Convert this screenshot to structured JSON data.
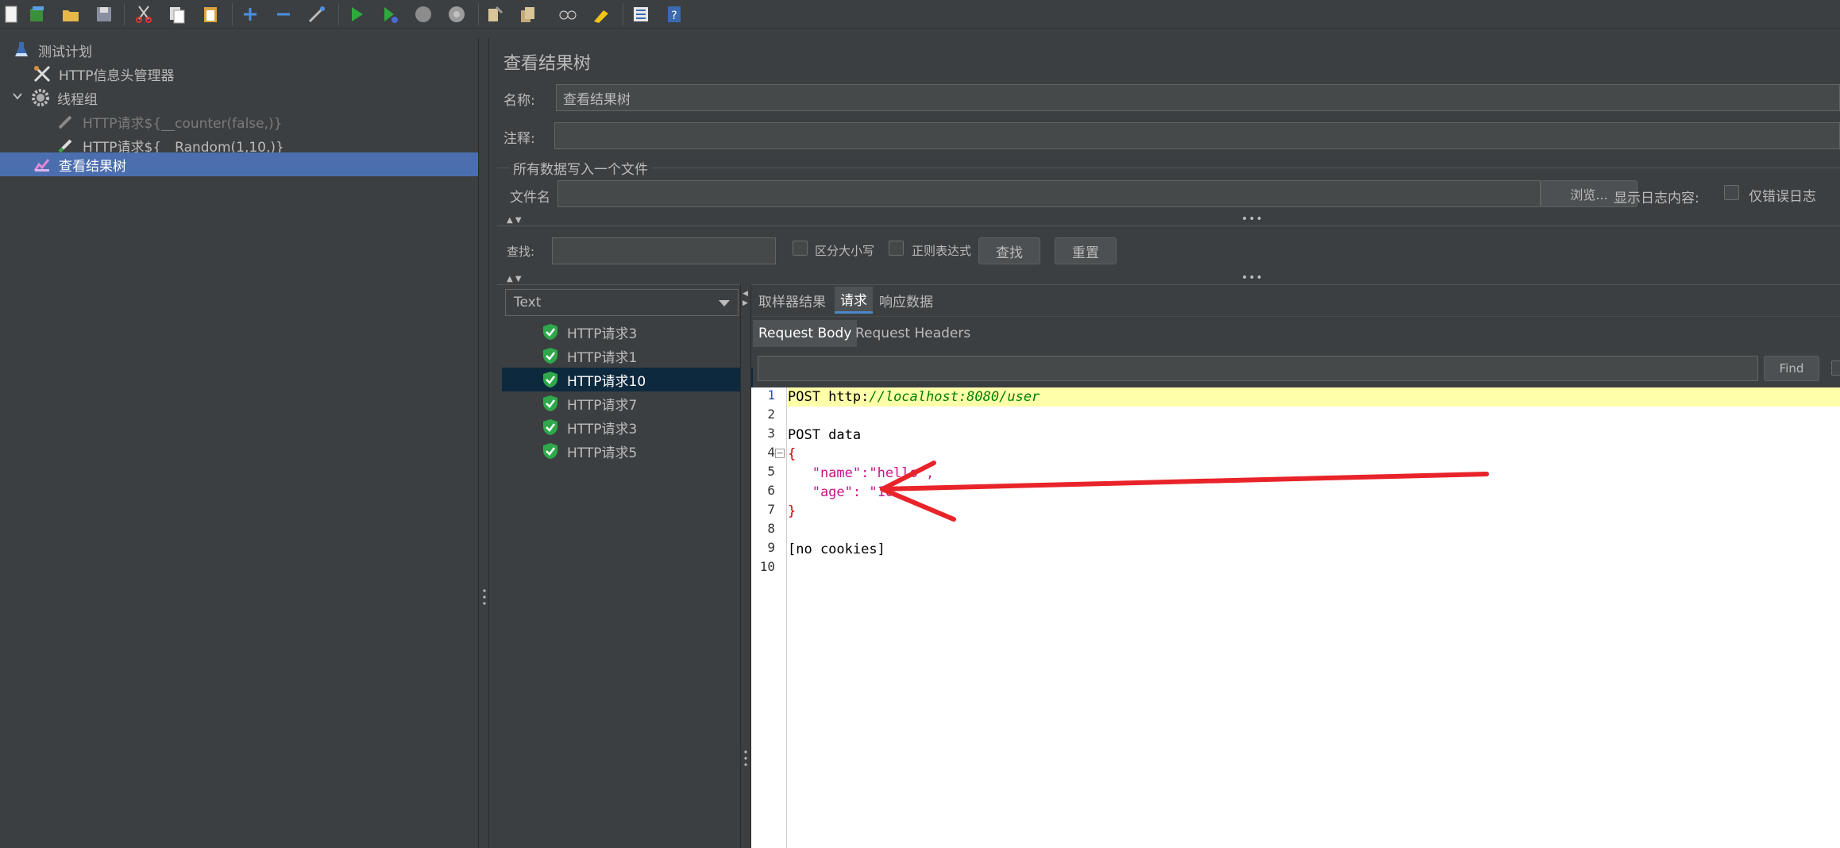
{
  "toolbar": {
    "icons": [
      "new-icon",
      "templates-icon",
      "open-icon",
      "save-icon",
      "cut-icon",
      "copy-icon",
      "paste-icon",
      "expand-icon",
      "collapse-icon",
      "toggle-icon",
      "start-icon",
      "start-no-pause-icon",
      "stop-icon",
      "shutdown-icon",
      "clear-icon",
      "clear-all-icon",
      "search-icon",
      "reset-search-icon",
      "function-helper-icon",
      "help-icon"
    ]
  },
  "tree": {
    "items": [
      {
        "label": "测试计划",
        "icon": "flask-icon"
      },
      {
        "label": "HTTP信息头管理器",
        "icon": "tools-icon"
      },
      {
        "label": "线程组",
        "icon": "gear-icon"
      },
      {
        "label": "HTTP请求${__counter(false,)}",
        "icon": "pipette-icon",
        "disabled": true
      },
      {
        "label": "HTTP请求${__Random(1,10,)}",
        "icon": "pipette-icon"
      },
      {
        "label": "查看结果树",
        "icon": "chart-icon",
        "selected": true
      }
    ]
  },
  "panel": {
    "title": "查看结果树",
    "name_label": "名称:",
    "name_value": "查看结果树",
    "comment_label": "注释:",
    "comment_value": "",
    "file_section": "所有数据写入一个文件",
    "filename_label": "文件名",
    "browse_button": "浏览...",
    "log_label": "显示日志内容:",
    "errors_only": "仅错误日志",
    "search_label": "查找:",
    "case_label": "区分大小写",
    "regex_label": "正则表达式",
    "find_button": "查找",
    "reset_button": "重置"
  },
  "results": {
    "renderer": "Text",
    "items": [
      {
        "label": "HTTP请求3"
      },
      {
        "label": "HTTP请求1"
      },
      {
        "label": "HTTP请求10",
        "selected": true
      },
      {
        "label": "HTTP请求7"
      },
      {
        "label": "HTTP请求3"
      },
      {
        "label": "HTTP请求5"
      }
    ]
  },
  "tabs": {
    "sampler": "取样器结果",
    "request": "请求",
    "response": "响应数据",
    "active": "请求"
  },
  "subtabs": {
    "body": "Request Body",
    "headers": "Request Headers",
    "active": "Request Body"
  },
  "editor": {
    "find_button": "Find",
    "line_numbers": [
      "1",
      "2",
      "3",
      "4",
      "5",
      "6",
      "7",
      "8",
      "9",
      "10"
    ],
    "lines": [
      {
        "text": "POST http://localhost:8080/user"
      },
      {
        "text": ""
      },
      {
        "text": "POST data"
      },
      {
        "text": "{"
      },
      {
        "text": "   \"name\":\"hello\","
      },
      {
        "text": "   \"age\": \"10\""
      },
      {
        "text": "}"
      },
      {
        "text": ""
      },
      {
        "text": "[no cookies]"
      },
      {
        "text": ""
      }
    ],
    "colors": {
      "url": "#008000",
      "string": "#c71585",
      "bracket": "#cc0000",
      "highlight": "#ffffaa",
      "annotation": "#e8242a"
    }
  }
}
